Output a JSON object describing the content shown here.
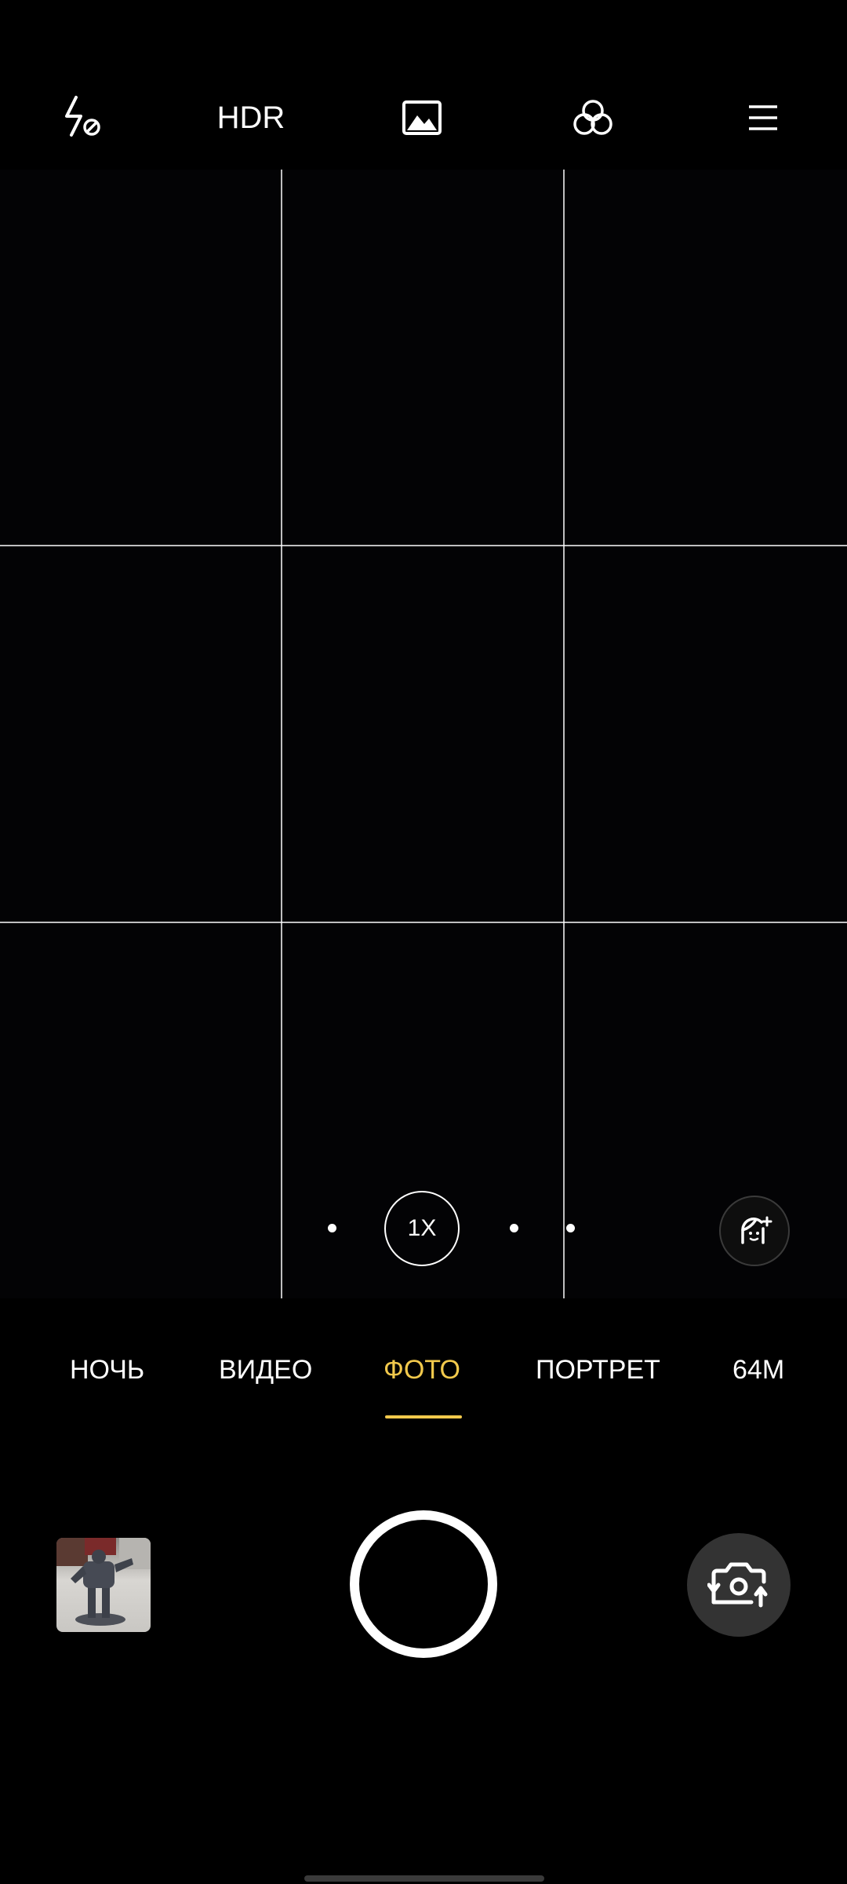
{
  "top_bar": {
    "flash_icon": "flash-off-icon",
    "hdr_label": "HDR",
    "photo_format_icon": "image-icon",
    "filters_icon": "filters-icon",
    "menu_icon": "menu-icon"
  },
  "zoom": {
    "current_label": "1X"
  },
  "beauty_icon": "beauty-face-icon",
  "modes": [
    {
      "label": "НОЧЬ"
    },
    {
      "label": "ВИДЕО"
    },
    {
      "label": "ФОТО"
    },
    {
      "label": "ПОРТРЕТ"
    },
    {
      "label": "64M"
    }
  ],
  "active_mode": "ФОТО",
  "colors": {
    "accent": "#f2c94c",
    "background": "#000000",
    "switch_button_bg": "#333333"
  },
  "bottom": {
    "gallery_thumbnail_icon": "gallery-thumbnail",
    "shutter_icon": "shutter-button",
    "switch_camera_icon": "switch-camera-icon"
  }
}
